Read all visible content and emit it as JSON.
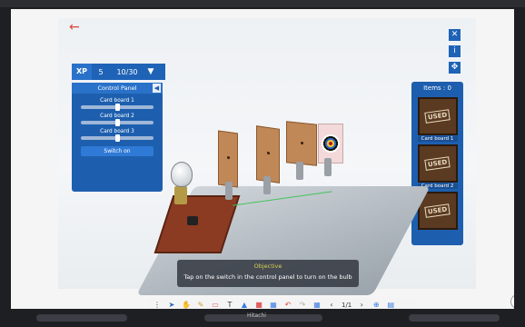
{
  "screen": {
    "back_icon": "arrow-left-icon",
    "close_icon": "close-icon",
    "info_icon": "info-icon",
    "move_icon": "move-icon"
  },
  "xp": {
    "label": "XP",
    "value": "5",
    "page": "10/30",
    "dropdown_icon": "chevron-down-icon"
  },
  "control_panel": {
    "title": "Control Panel",
    "collapse_icon": "chevron-left-icon",
    "sliders": [
      {
        "label": "Card board 1",
        "value": 0.5
      },
      {
        "label": "Card board 2",
        "value": 0.5
      },
      {
        "label": "Card board 3",
        "value": 0.5
      }
    ],
    "switch_label": "Switch on"
  },
  "items_panel": {
    "title": "Items : 0",
    "items": [
      {
        "label": "Card board 1",
        "badge": "USED"
      },
      {
        "label": "Card board 2",
        "badge": "USED"
      },
      {
        "label": "",
        "badge": "USED"
      }
    ]
  },
  "objective": {
    "title": "Objective",
    "text": "Tap on the switch in the control panel to turn on the bulb"
  },
  "toolbar": {
    "page_indicator": "1/1",
    "prev_icon": "chevron-left-icon",
    "next_icon": "chevron-right-icon"
  },
  "bezel": {
    "brand": "Hitachi"
  }
}
